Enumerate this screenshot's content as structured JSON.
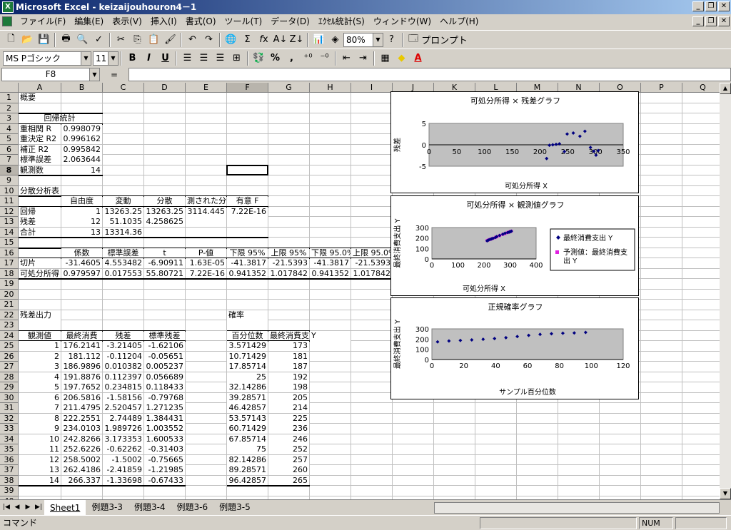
{
  "window": {
    "title": "Microsoft Excel - keizaijouhouron4－1"
  },
  "menu": [
    "ファイル(F)",
    "編集(E)",
    "表示(V)",
    "挿入(I)",
    "書式(O)",
    "ツール(T)",
    "データ(D)",
    "ｴｸｾﾙ統計(S)",
    "ウィンドウ(W)",
    "ヘルプ(H)"
  ],
  "toolbar": {
    "zoom": "80%",
    "help": "?",
    "pronto": "プロンプト",
    "font": "MS Pゴシック",
    "size": "11",
    "bold": "B",
    "italic": "I",
    "underline": "U",
    "percent": "%",
    "comma": ","
  },
  "formula_bar": {
    "name_box": "F8",
    "eq": "="
  },
  "columns": [
    "A",
    "B",
    "C",
    "D",
    "E",
    "F",
    "G",
    "H",
    "I",
    "J",
    "K",
    "L",
    "M",
    "N",
    "O",
    "P",
    "Q"
  ],
  "rows": [
    "1",
    "2",
    "3",
    "4",
    "5",
    "6",
    "7",
    "8",
    "9",
    "10",
    "11",
    "12",
    "13",
    "14",
    "15",
    "16",
    "17",
    "18",
    "19",
    "20",
    "21",
    "22",
    "23",
    "24",
    "25",
    "26",
    "27",
    "28",
    "29",
    "30",
    "31",
    "32",
    "33",
    "34",
    "35",
    "36",
    "37",
    "38",
    "39",
    "40"
  ],
  "cells": {
    "summary": "概要",
    "reg_stats": "回帰統計",
    "stats_labels": [
      "重相関 R",
      "重決定 R2",
      "補正 R2",
      "標準誤差",
      "観測数"
    ],
    "stats_values": [
      "0.998079",
      "0.996162",
      "0.995842",
      "2.063644",
      "14"
    ],
    "anova": "分散分析表",
    "anova_hdr": [
      "自由度",
      "変動",
      "分散",
      "測された分散",
      "有意 F"
    ],
    "anova_rows": [
      [
        "回帰",
        "1",
        "13263.25",
        "13263.25",
        "3114.445",
        "7.22E-16"
      ],
      [
        "残差",
        "12",
        "51.1035",
        "4.258625",
        "",
        ""
      ],
      [
        "合計",
        "13",
        "13314.36",
        "",
        "",
        ""
      ]
    ],
    "coef_hdr": [
      "係数",
      "標準誤差",
      "t",
      "P-値",
      "下限 95%",
      "上限 95%",
      "下限 95.0%",
      "上限 95.0%"
    ],
    "coef_rows": [
      [
        "切片",
        "-31.4605",
        "4.553482",
        "-6.90911",
        "1.63E-05",
        "-41.3817",
        "-21.5393",
        "-41.3817",
        "-21.5393"
      ],
      [
        "可処分所得",
        "0.979597",
        "0.017553",
        "55.80721",
        "7.22E-16",
        "0.941352",
        "1.017842",
        "0.941352",
        "1.017842"
      ]
    ],
    "resid_title": "残差出力",
    "resid_hdr": [
      "観測値",
      "最終消費",
      "残差",
      "標準残差"
    ],
    "resid_rows": [
      [
        "1",
        "176.2141",
        "-3.21405",
        "-1.62106"
      ],
      [
        "2",
        "181.112",
        "-0.11204",
        "-0.05651"
      ],
      [
        "3",
        "186.9896",
        "0.010382",
        "0.005237"
      ],
      [
        "4",
        "191.8876",
        "0.112397",
        "0.056689"
      ],
      [
        "5",
        "197.7652",
        "0.234815",
        "0.118433"
      ],
      [
        "6",
        "206.5816",
        "-1.58156",
        "-0.79768"
      ],
      [
        "7",
        "211.4795",
        "2.520457",
        "1.271235"
      ],
      [
        "8",
        "222.2551",
        "2.74489",
        "1.384431"
      ],
      [
        "9",
        "234.0103",
        "1.989726",
        "1.003552"
      ],
      [
        "10",
        "242.8266",
        "3.173353",
        "1.600533"
      ],
      [
        "11",
        "252.6226",
        "-0.62262",
        "-0.31403"
      ],
      [
        "12",
        "258.5002",
        "-1.5002",
        "-0.75665"
      ],
      [
        "13",
        "262.4186",
        "-2.41859",
        "-1.21985"
      ],
      [
        "14",
        "266.337",
        "-1.33698",
        "-0.67433"
      ]
    ],
    "prob_title": "確率",
    "prob_hdr": [
      "百分位数",
      "最終消費支出",
      "Y"
    ],
    "prob_rows": [
      [
        "3.571429",
        "173"
      ],
      [
        "10.71429",
        "181"
      ],
      [
        "17.85714",
        "187"
      ],
      [
        "25",
        "192"
      ],
      [
        "32.14286",
        "198"
      ],
      [
        "39.28571",
        "205"
      ],
      [
        "46.42857",
        "214"
      ],
      [
        "53.57143",
        "225"
      ],
      [
        "60.71429",
        "236"
      ],
      [
        "67.85714",
        "246"
      ],
      [
        "75",
        "252"
      ],
      [
        "82.14286",
        "257"
      ],
      [
        "89.28571",
        "260"
      ],
      [
        "96.42857",
        "265"
      ]
    ]
  },
  "chart_data": [
    {
      "type": "scatter",
      "title": "可処分所得 × 残差グラフ",
      "xlabel": "可処分所得 X",
      "ylabel": "残差",
      "xlim": [
        0,
        350
      ],
      "ylim": [
        -5,
        5
      ],
      "xticks": [
        "0",
        "50",
        "100",
        "150",
        "200",
        "250",
        "300",
        "350"
      ],
      "yticks": [
        "5",
        "0",
        "-5"
      ],
      "x": [
        212,
        217,
        223,
        229,
        235,
        244,
        249,
        260,
        272,
        281,
        291,
        297,
        301,
        305
      ],
      "y": [
        -3.21,
        -0.11,
        0.01,
        0.11,
        0.23,
        -1.58,
        2.52,
        2.74,
        1.99,
        3.17,
        -0.62,
        -1.5,
        -2.42,
        -1.34
      ]
    },
    {
      "type": "scatter",
      "title": "可処分所得 × 観測値グラフ",
      "xlabel": "可処分所得 X",
      "ylabel": "最終消費支出 Y",
      "xlim": [
        0,
        400
      ],
      "ylim": [
        0,
        300
      ],
      "xticks": [
        "0",
        "100",
        "200",
        "300",
        "400"
      ],
      "yticks": [
        "300",
        "200",
        "100",
        "0"
      ],
      "legend": [
        "最終消費支出 Y",
        "予測値：最終消費支出 Y"
      ],
      "x": [
        212,
        217,
        223,
        229,
        235,
        244,
        249,
        260,
        272,
        281,
        291,
        297,
        301,
        305
      ],
      "series": [
        {
          "name": "最終消費支出 Y",
          "values": [
            173,
            181,
            187,
            192,
            198,
            205,
            214,
            225,
            236,
            246,
            252,
            257,
            260,
            265
          ]
        },
        {
          "name": "予測値：最終消費支出 Y",
          "values": [
            176.2,
            181.1,
            187.0,
            191.9,
            197.8,
            206.6,
            211.5,
            222.3,
            234.0,
            242.8,
            252.6,
            258.5,
            262.4,
            266.3
          ]
        }
      ]
    },
    {
      "type": "scatter",
      "title": "正規確率グラフ",
      "xlabel": "サンプル百分位数",
      "ylabel": "最終消費支出 Y",
      "xlim": [
        0,
        120
      ],
      "ylim": [
        0,
        300
      ],
      "xticks": [
        "0",
        "20",
        "40",
        "60",
        "80",
        "100",
        "120"
      ],
      "yticks": [
        "300",
        "200",
        "100",
        "0"
      ],
      "x": [
        3.57,
        10.71,
        17.86,
        25,
        32.14,
        39.29,
        46.43,
        53.57,
        60.71,
        67.86,
        75,
        82.14,
        89.29,
        96.43
      ],
      "y": [
        173,
        181,
        187,
        192,
        198,
        205,
        214,
        225,
        236,
        246,
        252,
        257,
        260,
        265
      ]
    }
  ],
  "sheets": [
    "Sheet1",
    "例題3-3",
    "例題3-4",
    "例題3-6",
    "例題3-5"
  ],
  "status": {
    "mode": "コマンド",
    "num": "NUM"
  }
}
